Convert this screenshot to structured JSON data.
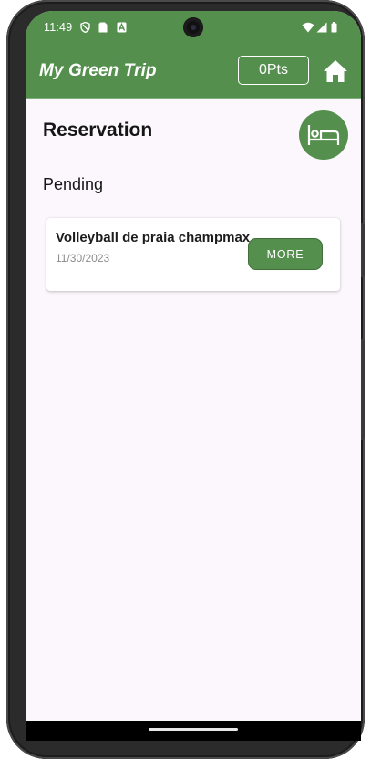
{
  "status_bar": {
    "time": "11:49",
    "icons": [
      "shield-icon",
      "sim-card-icon",
      "font-a-icon",
      "wifi-icon",
      "cell-signal-icon",
      "battery-icon"
    ]
  },
  "app_bar": {
    "title": "My Green Trip",
    "points": "0Pts",
    "home_icon": "home-icon"
  },
  "page": {
    "title": "Reservation",
    "action_icon": "bed-icon",
    "section": "Pending"
  },
  "reservations": [
    {
      "title": "Volleyball de praia champmax",
      "date": "11/30/2023",
      "button": "MORE"
    }
  ],
  "colors": {
    "brand_green": "#548f4d",
    "background": "#fcf7fc",
    "text": "#151515",
    "muted_text": "#8c8c8c"
  }
}
